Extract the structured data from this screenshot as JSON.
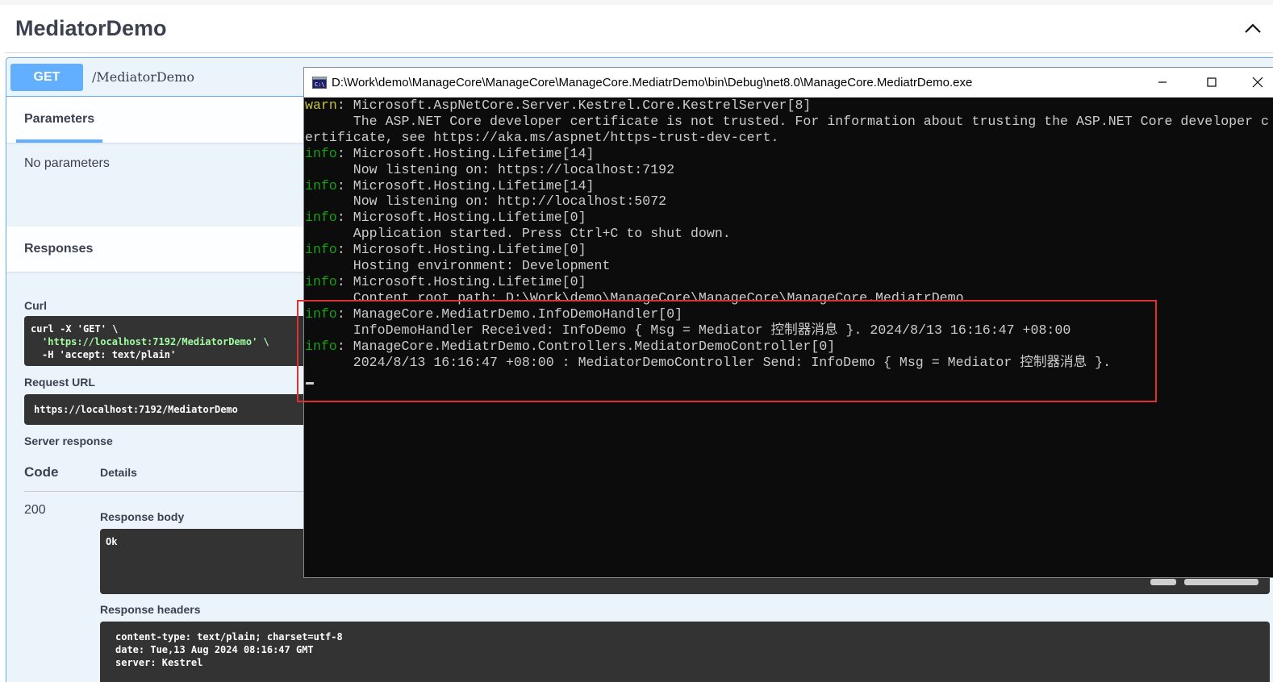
{
  "tag": {
    "title": "MediatorDemo"
  },
  "operation": {
    "method": "GET",
    "path": "/MediatorDemo"
  },
  "parameters": {
    "tab_label": "Parameters",
    "empty_text": "No parameters"
  },
  "responses": {
    "title": "Responses",
    "curl_label": "Curl",
    "curl_lines": [
      "curl -X 'GET' \\",
      "'https://localhost:7192/MediatorDemo' \\",
      "-H 'accept: text/plain'"
    ],
    "request_url_label": "Request URL",
    "request_url": "https://localhost:7192/MediatorDemo",
    "server_response_label": "Server response",
    "code_header": "Code",
    "details_header": "Details",
    "status_code": "200",
    "response_body_label": "Response body",
    "response_body": "Ok",
    "response_headers_label": "Response headers",
    "response_headers": [
      "content-type: text/plain; charset=utf-8",
      "date: Tue,13 Aug 2024 08:16:47 GMT",
      "server: Kestrel"
    ]
  },
  "console": {
    "title": "D:\\Work\\demo\\ManageCore\\ManageCore\\ManageCore.MediatrDemo\\bin\\Debug\\net8.0\\ManageCore.MediatrDemo.exe",
    "lines": [
      {
        "level": "warn",
        "text": ": Microsoft.AspNetCore.Server.Kestrel.Core.KestrelServer[8]"
      },
      {
        "level": "",
        "text": "      The ASP.NET Core developer certificate is not trusted. For information about trusting the ASP.NET Core developer c"
      },
      {
        "level": "",
        "text": "ertificate, see https://aka.ms/aspnet/https-trust-dev-cert."
      },
      {
        "level": "info",
        "text": ": Microsoft.Hosting.Lifetime[14]"
      },
      {
        "level": "",
        "text": "      Now listening on: https://localhost:7192"
      },
      {
        "level": "info",
        "text": ": Microsoft.Hosting.Lifetime[14]"
      },
      {
        "level": "",
        "text": "      Now listening on: http://localhost:5072"
      },
      {
        "level": "info",
        "text": ": Microsoft.Hosting.Lifetime[0]"
      },
      {
        "level": "",
        "text": "      Application started. Press Ctrl+C to shut down."
      },
      {
        "level": "info",
        "text": ": Microsoft.Hosting.Lifetime[0]"
      },
      {
        "level": "",
        "text": "      Hosting environment: Development"
      },
      {
        "level": "info",
        "text": ": Microsoft.Hosting.Lifetime[0]"
      },
      {
        "level": "",
        "text": "      Content root path: D:\\Work\\demo\\ManageCore\\ManageCore\\ManageCore.MediatrDemo"
      },
      {
        "level": "info",
        "text": ": ManageCore.MediatrDemo.InfoDemoHandler[0]"
      },
      {
        "level": "",
        "text": "      InfoDemoHandler Received: InfoDemo { Msg = Mediator 控制器消息 }. 2024/8/13 16:16:47 +08:00"
      },
      {
        "level": "info",
        "text": ": ManageCore.MediatrDemo.Controllers.MediatorDemoController[0]"
      },
      {
        "level": "",
        "text": "      2024/8/13 16:16:47 +08:00 : MediatorDemoController Send: InfoDemo { Msg = Mediator 控制器消息 }."
      }
    ]
  },
  "colors": {
    "get_blue": "#61affe",
    "console_bg": "#0c0c0c",
    "info_green": "#13a10e",
    "warn_yellow": "#c5c542",
    "highlight_red": "#e03131"
  }
}
